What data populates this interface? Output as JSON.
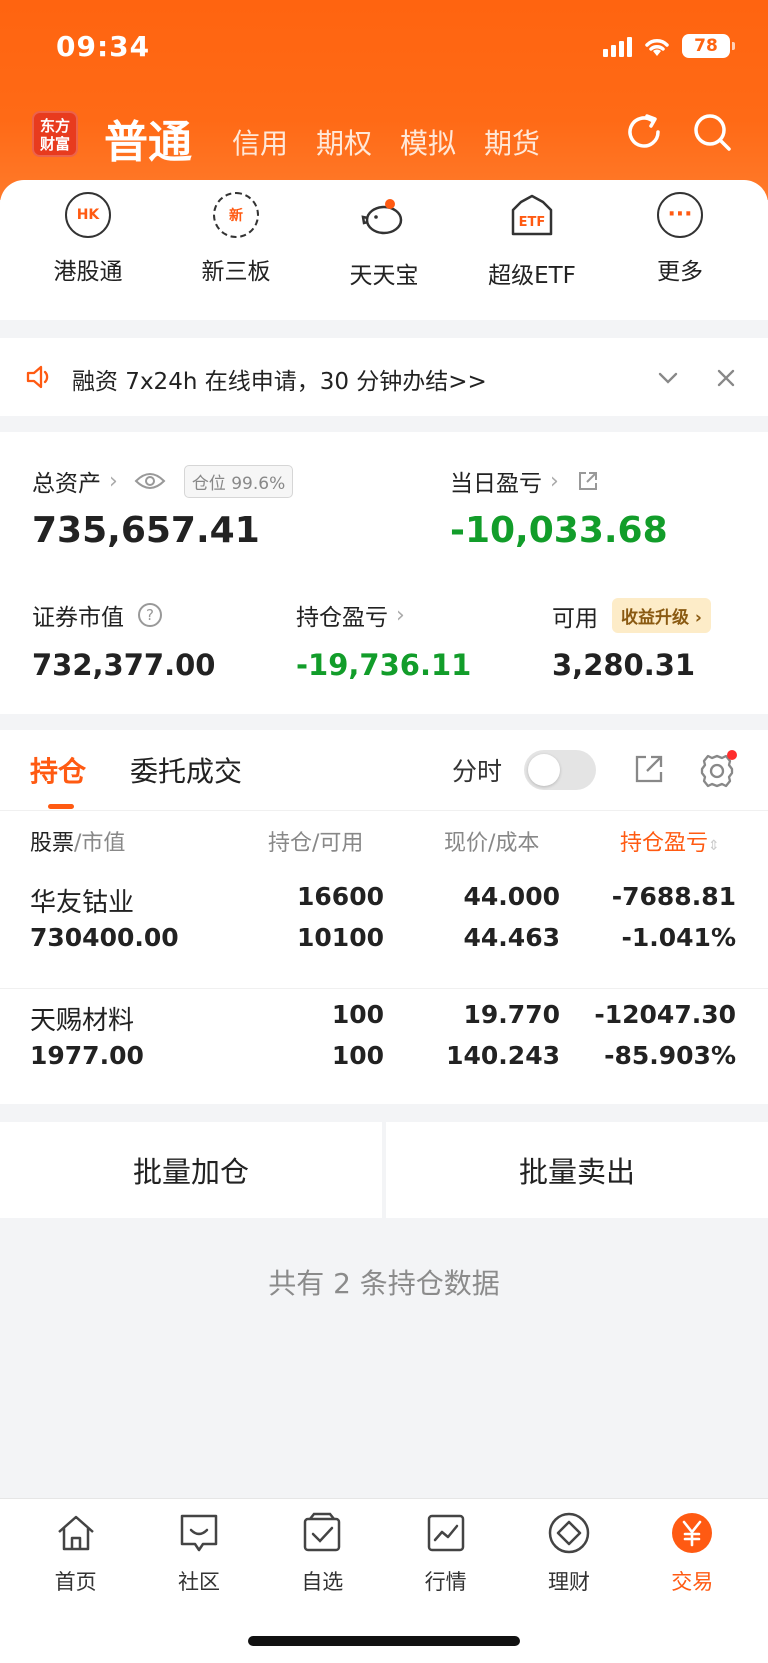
{
  "status_bar": {
    "time": "09:34",
    "battery": "78"
  },
  "header": {
    "logo_lines": [
      "东方",
      "财富"
    ],
    "active_account": "普通",
    "account_tabs": [
      "信用",
      "期权",
      "模拟",
      "期货"
    ]
  },
  "shortcuts": [
    {
      "label": "港股通",
      "icon_text": "HK"
    },
    {
      "label": "新三板",
      "icon_text": "新"
    },
    {
      "label": "天天宝",
      "icon_text": ""
    },
    {
      "label": "超级ETF",
      "icon_text": "ETF"
    },
    {
      "label": "更多",
      "icon_text": "···"
    }
  ],
  "notice": {
    "text": "融资 7x24h 在线申请，30 分钟办结>>"
  },
  "assets": {
    "total_label": "总资产",
    "position_pill": "仓位 99.6%",
    "total_value": "735,657.41",
    "daily_pl_label": "当日盈亏",
    "daily_pl_value": "-10,033.68",
    "market_value_label": "证券市值",
    "market_value": "732,377.00",
    "holding_pl_label": "持仓盈亏",
    "holding_pl_value": "-19,736.11",
    "available_label": "可用",
    "available_badge": "收益升级",
    "available_value": "3,280.31"
  },
  "holdings": {
    "tab_active": "持仓",
    "tab_other": "委托成交",
    "fenshi_label": "分时",
    "columns": {
      "stock": "股票",
      "stock_sub": "/市值",
      "qty": "持仓",
      "qty_sub": "/可用",
      "price": "现价",
      "price_sub": "/成本",
      "pl": "持仓盈亏"
    },
    "rows": [
      {
        "name": "华友钴业",
        "market_value": "730400.00",
        "qty": "16600",
        "available": "10100",
        "price": "44.000",
        "cost": "44.463",
        "pl": "-7688.81",
        "pl_pct": "-1.041%"
      },
      {
        "name": "天赐材料",
        "market_value": "1977.00",
        "qty": "100",
        "available": "100",
        "price": "19.770",
        "cost": "140.243",
        "pl": "-12047.30",
        "pl_pct": "-85.903%"
      }
    ]
  },
  "batch": {
    "add": "批量加仓",
    "sell": "批量卖出"
  },
  "summary": "共有 2 条持仓数据",
  "tabbar": [
    {
      "label": "首页",
      "icon": "home-icon"
    },
    {
      "label": "社区",
      "icon": "chat-icon"
    },
    {
      "label": "自选",
      "icon": "check-icon"
    },
    {
      "label": "行情",
      "icon": "chart-icon"
    },
    {
      "label": "理财",
      "icon": "diamond-icon"
    },
    {
      "label": "交易",
      "icon": "yen-icon"
    }
  ],
  "colors": {
    "brand": "#ff6410",
    "loss": "#129d2a",
    "accent": "#ff5a12"
  }
}
